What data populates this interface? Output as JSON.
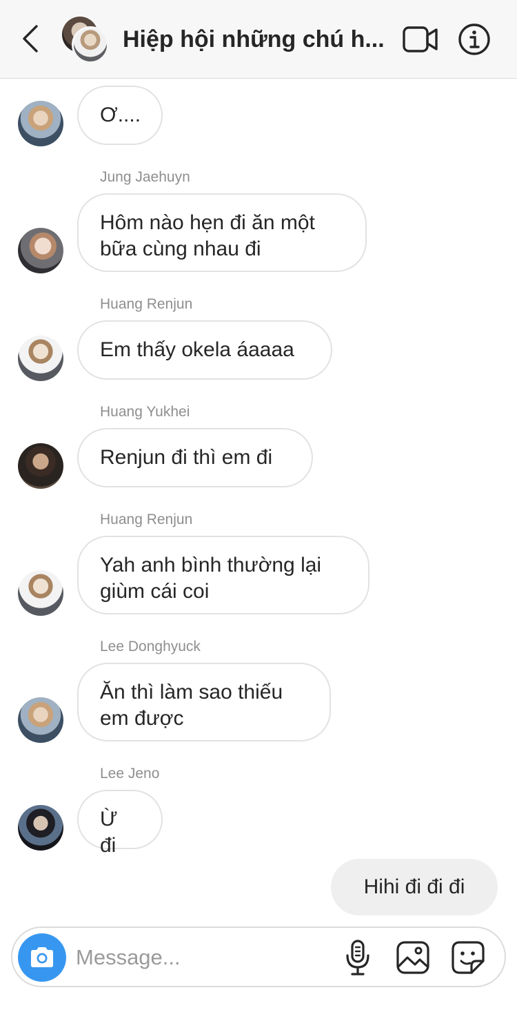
{
  "header": {
    "title": "Hiệp hội những chú h..."
  },
  "messages": [
    {
      "sender": "",
      "text_lines": [
        "Ơ...."
      ],
      "avatar": "haechan-avatar"
    },
    {
      "sender": "Jung Jaehuyn",
      "text_lines": [
        "Hôm nào hẹn đi ăn một",
        "bữa cùng nhau đi"
      ],
      "avatar": "jaehyun-avatar"
    },
    {
      "sender": "Huang Renjun",
      "text_lines": [
        "Em thấy okela áaaaa"
      ],
      "avatar": "renjun-avatar"
    },
    {
      "sender": "Huang Yukhei",
      "text_lines": [
        "Renjun đi thì em đi"
      ],
      "avatar": "lucas-avatar"
    },
    {
      "sender": "Huang Renjun",
      "text_lines": [
        "Yah anh bình thường lại",
        "giùm cái coi"
      ],
      "avatar": "renjun-avatar"
    },
    {
      "sender": "Lee Donghyuck",
      "text_lines": [
        "Ăn thì làm sao thiếu",
        "em được"
      ],
      "avatar": "haechan-avatar"
    },
    {
      "sender": "Lee Jeno",
      "text_lines": [
        "Ừ đi"
      ],
      "avatar": "jeno-avatar"
    }
  ],
  "outgoing": {
    "text": "Hihi đi đi đi"
  },
  "composer": {
    "placeholder": "Message...",
    "value": ""
  },
  "colors": {
    "accent": "#3797f0",
    "bubble_border": "#e2e2e2",
    "outgoing_bg": "#efefef",
    "meta_text": "#8e8e8e"
  },
  "icons": [
    "back-arrow-icon",
    "video-call-icon",
    "info-icon",
    "camera-icon",
    "microphone-icon",
    "gallery-icon",
    "sticker-icon"
  ]
}
